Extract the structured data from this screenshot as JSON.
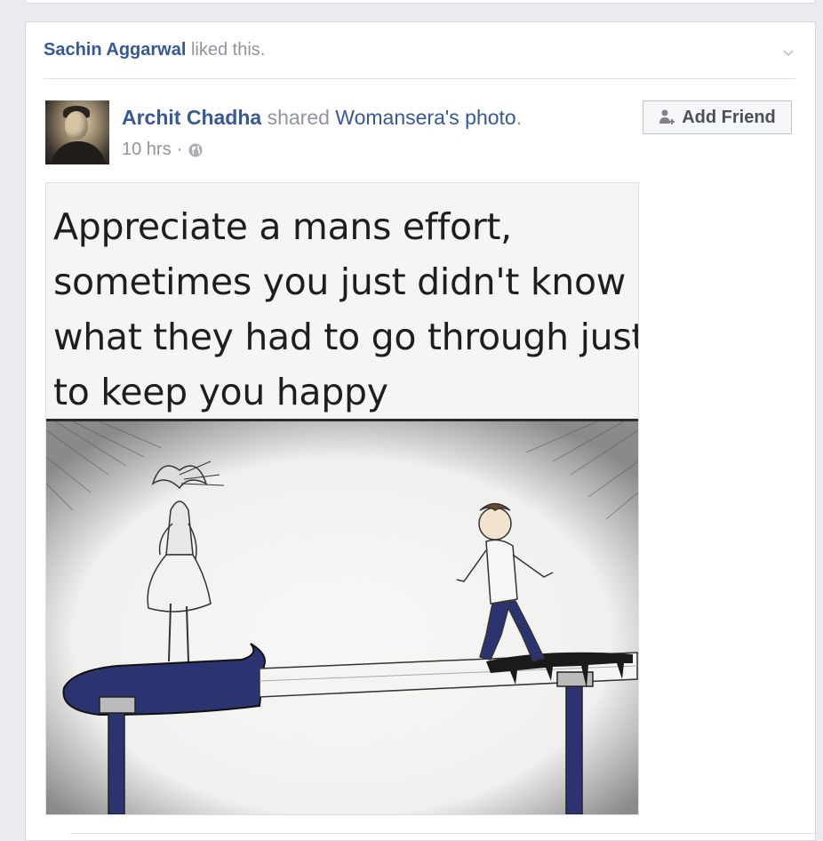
{
  "story": {
    "actor": "Sachin Aggarwal",
    "action": "liked this."
  },
  "post": {
    "author": "Archit Chadha",
    "verb": "shared",
    "source": "Womansera",
    "source_suffix": "'s",
    "object": "photo",
    "period": ".",
    "time": "10 hrs",
    "separator": "·",
    "add_friend_label": "Add Friend",
    "photo_caption": [
      "Appreciate a mans effort,",
      "sometimes you just didn't know",
      "what they had to go through just",
      "to keep you happy"
    ]
  },
  "icons": {
    "chevron": "chevron-down-icon",
    "privacy": "globe-icon",
    "add_friend": "add-friend-icon"
  },
  "colors": {
    "link": "#365899",
    "muted": "#90949c",
    "background": "#e9ebee",
    "knife_handle": "#2b3470"
  }
}
